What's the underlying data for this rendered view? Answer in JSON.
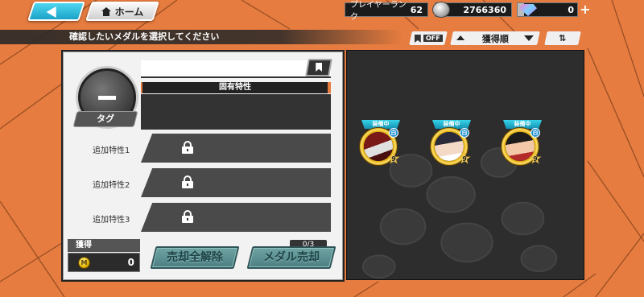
{
  "header": {
    "back_label": "",
    "home_label": "ホーム",
    "player_rank_label": "プレイヤーランク",
    "player_rank_value": "62",
    "coins_value": "2766360",
    "gems_value": "0",
    "plus_label": "+"
  },
  "toolbar": {
    "instruction": "確認したいメダルを選択してください",
    "bookmark_filter_state": "OFF",
    "sort_label": "獲得順"
  },
  "detail": {
    "unique_trait_label": "固有特性",
    "tag_label": "タグ",
    "extra_traits": [
      {
        "label": "追加特性1"
      },
      {
        "label": "追加特性2"
      },
      {
        "label": "追加特性3"
      }
    ],
    "acquire_label": "獲得",
    "acquire_value": "0",
    "acquire_coin_letter": "M",
    "sell_all_cancel_label": "売却全解除",
    "sell_label": "メダル売却",
    "sell_count": "0/3"
  },
  "medals": [
    {
      "status": "装備中",
      "type": "白",
      "level": "9",
      "colors": [
        "#7a1818",
        "#e0e0e0"
      ]
    },
    {
      "status": "装備中",
      "type": "白",
      "level": "9",
      "colors": [
        "#2a2a3a",
        "#f3d9c6"
      ]
    },
    {
      "status": "装備中",
      "type": "白",
      "level": "9",
      "colors": [
        "#1c1c1c",
        "#f2c8a8"
      ]
    }
  ],
  "colors": {
    "background": "#e67c3f",
    "accent_cyan": "#36d3e8",
    "panel_dark": "#2d2d2d"
  }
}
